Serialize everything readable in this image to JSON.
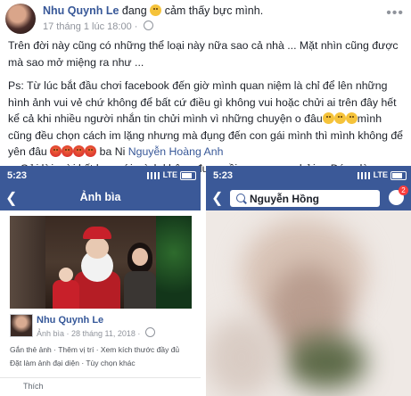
{
  "post": {
    "author": "Nhu Quynh Le",
    "feeling_prefix": "đang",
    "feeling_text": "cảm thấy bực mình.",
    "timestamp": "17 tháng 1 lúc 18:00",
    "paragraph1": "Trên đời này cũng có những thể loại này nữa sao cả nhà ... Mặt nhìn cũng được mà sao mở miệng ra như ...",
    "paragraph2_part1": "Ps: Từ lúc bắt đầu chơi facebook đến giờ mình quan niệm là chỉ để lên những hình ảnh vui vẻ chứ không để bất cứ điều gì không vui hoặc chửi ai trên đây hết kể cả khi nhiều người nhắn tin chửi mình vì những chuyện o đâu",
    "paragraph2_part2": "mình cũng đều chọn cách im lặng nhưng mà đụng đến con gái mình thì mình không để yên đâu",
    "paragraph2_part3": "ba Ni",
    "mention": "Nguyễn Hoàng Anh",
    "paragraph3": "... Gửi lời mời kết bạn với mình không được rồi quay sang chửi ... Đúng là ..."
  },
  "left_screenshot": {
    "time": "5:23",
    "network": "LTE",
    "title": "Ảnh bìa",
    "profile_name": "Nhu Quynh Le",
    "profile_meta": "Ảnh bìa · 28 tháng 11, 2018 · ",
    "action_line1": "Gắn thẻ ảnh · Thêm vị trí · Xem kích thước đầy đủ",
    "action_line2": "Đặt làm ảnh đại diện · Tùy chọn khác",
    "like_label": "Thích"
  },
  "right_screenshot": {
    "time": "5:23",
    "network": "LTE",
    "search_query": "Nguyễn Hồng",
    "messenger_badge": "2"
  },
  "colors": {
    "facebook_blue": "#3b5998",
    "link_blue": "#385898",
    "meta_gray": "#90949c"
  }
}
